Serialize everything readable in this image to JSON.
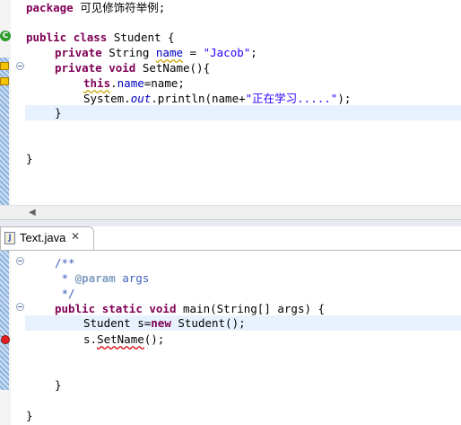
{
  "top_editor": {
    "lines": {
      "l1": {
        "kw": "package",
        "text": " 可见修饰符举例;"
      },
      "l3": {
        "kw1": "public",
        "kw2": "class",
        "text": " Student {"
      },
      "l4": {
        "kw": "private",
        "t1": " String ",
        "field": "name",
        "t2": " = ",
        "str": "\"Jacob\"",
        "t3": ";"
      },
      "l5": {
        "kw1": "private",
        "kw2": "void",
        "t1": " SetName(){"
      },
      "l6": {
        "kw": "this",
        "t1": ".",
        "field": "name",
        "t2": "=name;"
      },
      "l7": {
        "t1": "System.",
        "field": "out",
        "t2": ".println(name+",
        "str": "\"正在学习.....\"",
        "t3": ");"
      },
      "l8": {
        "text": "}"
      },
      "l11": {
        "text": "}"
      }
    }
  },
  "tab": {
    "title": "Text.java",
    "icon": "J",
    "close": "✕"
  },
  "bottom_editor": {
    "lines": {
      "b1": {
        "doc": "/**"
      },
      "b2": {
        "doc1": " * ",
        "tag": "@param",
        "doc2": " args"
      },
      "b3": {
        "doc": " */"
      },
      "b4": {
        "kw1": "public",
        "kw2": "static",
        "kw3": "void",
        "t1": " main(String[] args) {"
      },
      "b5": {
        "t1": "Student s=",
        "kw": "new",
        "t2": " Student();"
      },
      "b6": {
        "t1": "s.",
        "call": "SetName",
        "t2": "();"
      },
      "b9": {
        "text": "}"
      },
      "b11": {
        "text": "}"
      }
    }
  },
  "icons": {
    "override_marker": "C",
    "scroll_left": "◀"
  },
  "colors": {
    "keyword": "#7f0055",
    "string": "#2a00ff",
    "field": "#0000c0",
    "javadoc": "#3f5fbf",
    "current_line": "#e8f2fe"
  }
}
